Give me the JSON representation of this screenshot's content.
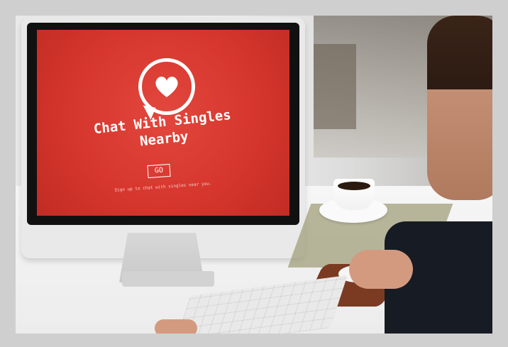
{
  "screen": {
    "title_line1": "Chat With Singles",
    "title_line2": "Nearby",
    "button_label": "GO",
    "subtext": "Sign up to chat with singles near you."
  },
  "colors": {
    "screen_red": "#d6362d",
    "frame_gray": "#cfcfcf",
    "white": "#ffffff"
  },
  "icons": {
    "chat_bubble": "chat-bubble-icon",
    "heart": "heart-icon"
  }
}
